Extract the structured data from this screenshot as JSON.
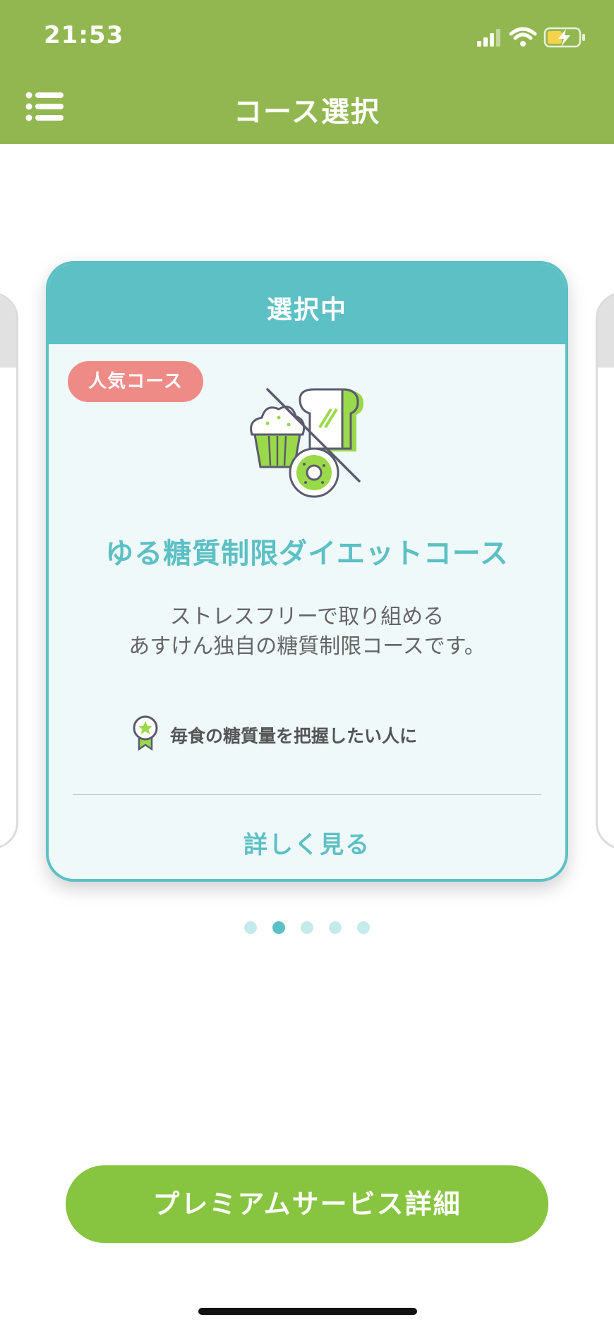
{
  "status_bar": {
    "time": "21:53",
    "icons": [
      "cellular-signal-icon",
      "wifi-icon",
      "battery-charging-icon"
    ]
  },
  "header": {
    "menu_icon": "list-menu-icon",
    "title": "コース選択"
  },
  "carousel": {
    "current_card": {
      "status_label": "選択中",
      "badge": "人気コース",
      "illustration_icon": "no-carbs-food-icon",
      "title": "ゆる糖質制限ダイエットコース",
      "description_line1": "ストレスフリーで取り組める",
      "description_line2": "あすけん独自の糖質制限コースです。",
      "recommend_icon": "award-ribbon-icon",
      "recommend_text": "毎食の糖質量を把握したい人に",
      "detail_link": "詳しく見る"
    },
    "page_count": 5,
    "active_page_index": 1
  },
  "premium_button": {
    "label": "プレミアムサービス詳細"
  },
  "colors": {
    "header_bg": "#93b750",
    "accent_teal": "#5cc0c4",
    "card_bg": "#eff9fa",
    "badge_pink": "#ef8b87",
    "button_green": "#87c540",
    "dot_inactive": "#c5eaec"
  }
}
